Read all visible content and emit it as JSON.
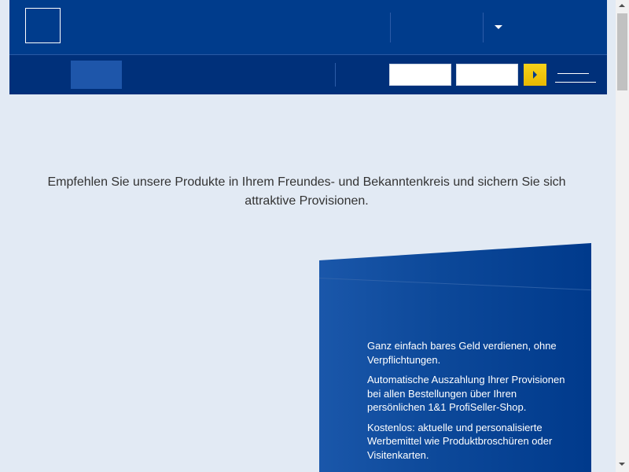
{
  "colors": {
    "header_blue": "#003c8c",
    "nav_blue": "#00307a",
    "nav_active": "#1e56aa",
    "accent_yellow": "#f7d21a",
    "page_background": "#e2eaf4",
    "text": "#333333"
  },
  "header": {
    "logo_icon": "logo-box-icon",
    "dropdown_icon": "caret-down-icon",
    "go_button_icon": "triangle-right-icon"
  },
  "search": {
    "field_1_value": "",
    "field_2_value": ""
  },
  "intro": {
    "text": "Empfehlen Sie unsere Produkte in Ihrem Freundes- und Bekanntenkreis und sichern Sie sich attraktive Provisionen."
  },
  "benefits": {
    "items": [
      "Ganz einfach bares Geld verdienen, ohne Verpflichtungen.",
      "Automatische Auszahlung Ihrer Provisionen bei allen Bestellungen über Ihren persönlichen 1&1 ProfiSeller-Shop.",
      "Kostenlos: aktuelle und personalisierte Werbemittel wie Produktbroschüren oder Visitenkarten."
    ]
  }
}
